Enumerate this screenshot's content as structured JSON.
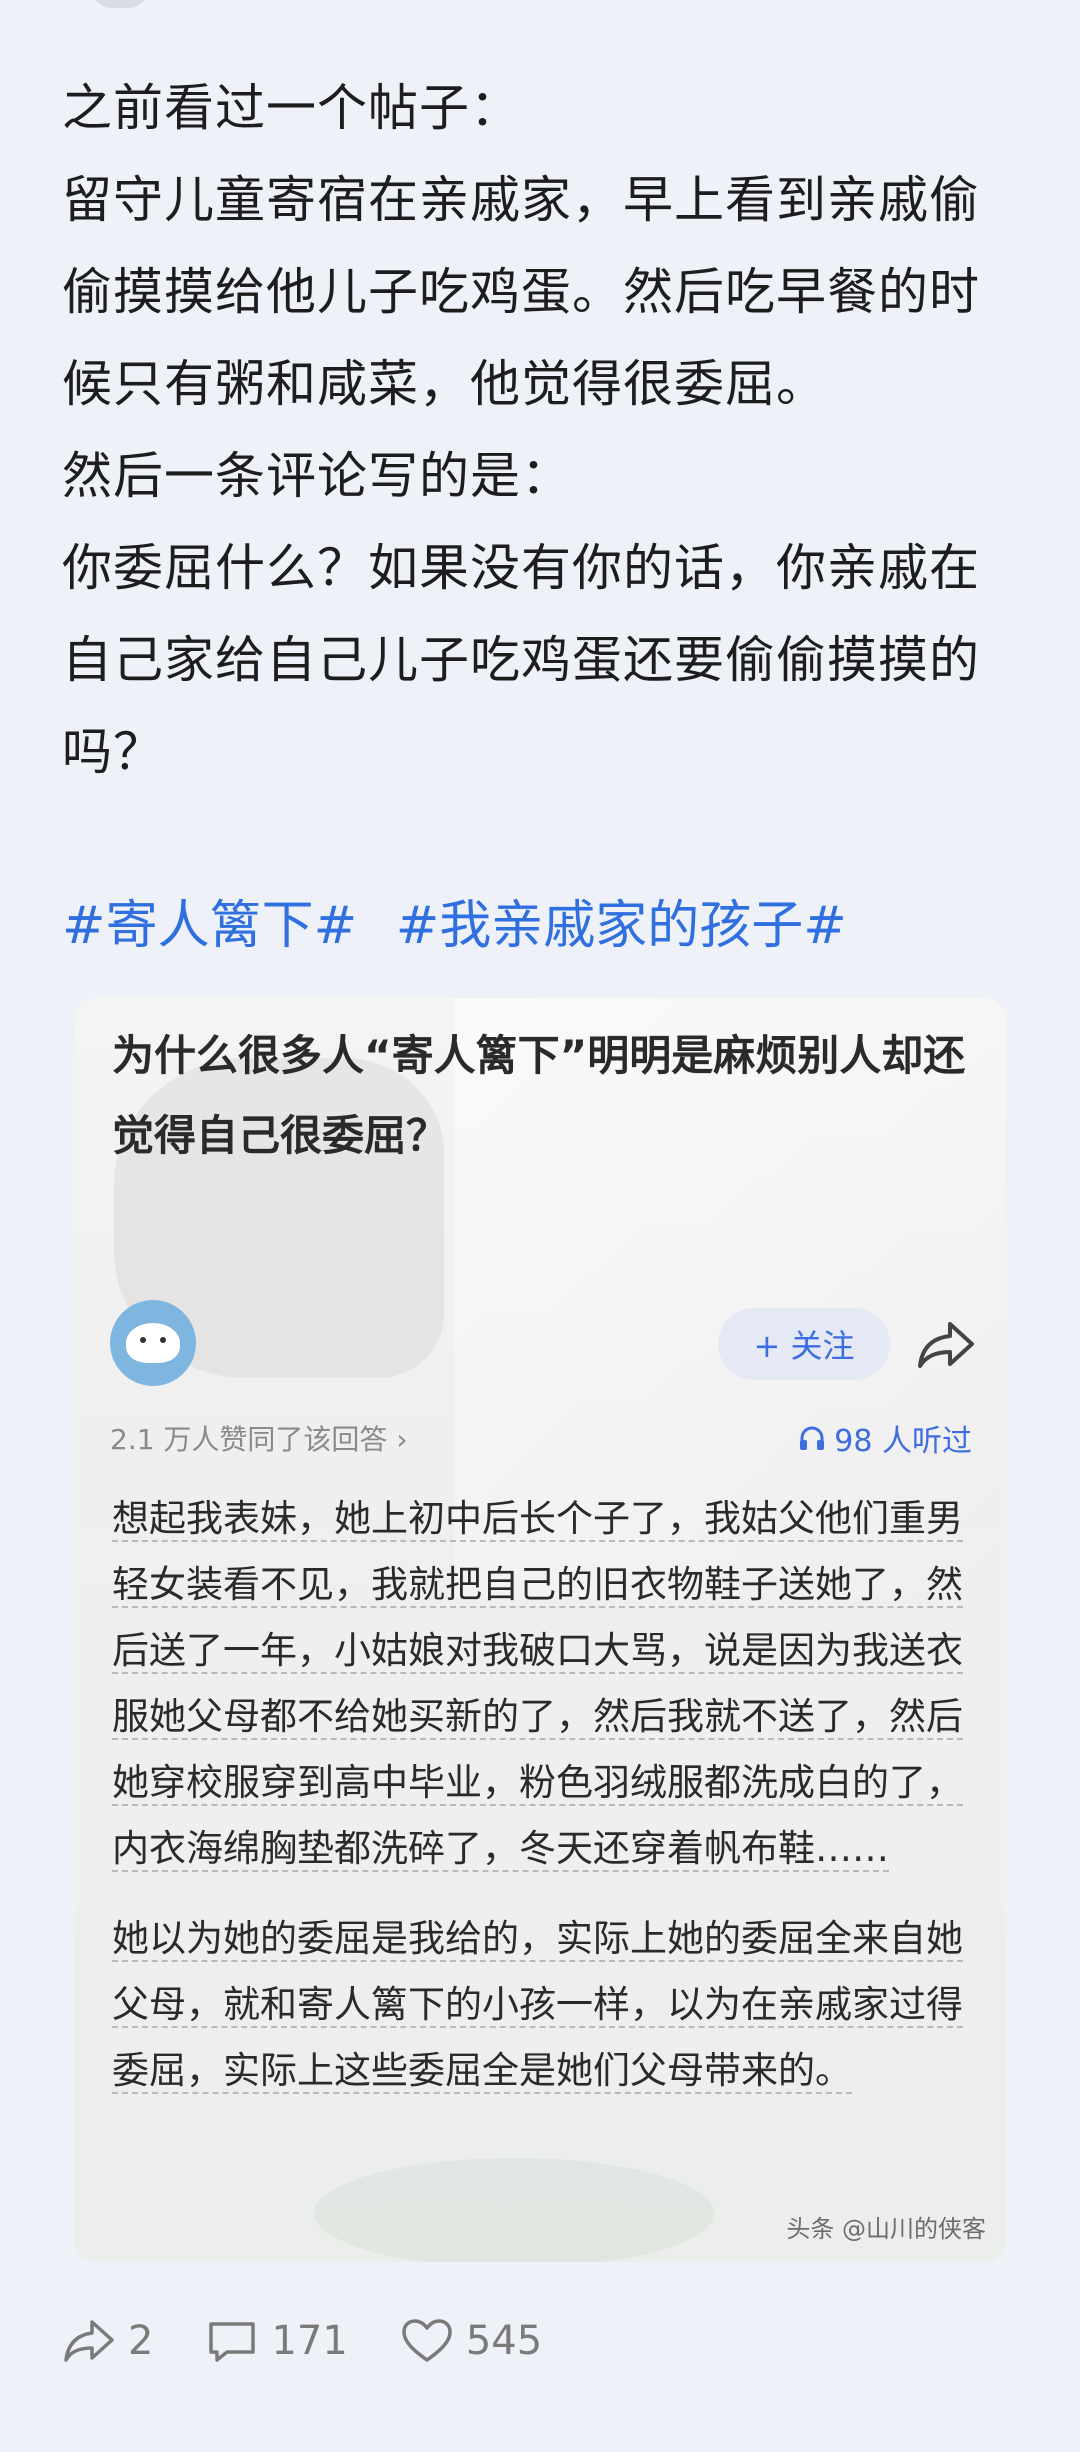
{
  "post": {
    "lines": [
      "之前看过一个帖子：",
      "留守儿童寄宿在亲戚家，早上看到亲戚偷偷摸摸给他儿子吃鸡蛋。然后吃早餐的时候只有粥和咸菜，他觉得很委屈。",
      "然后一条评论写的是：",
      "你委屈什么？如果没有你的话，你亲戚在自己家给自己儿子吃鸡蛋还要偷偷摸摸的吗？"
    ],
    "hashtags": [
      "#寄人篱下#",
      "#我亲戚家的孩子#"
    ]
  },
  "card": {
    "title": "为什么很多人“寄人篱下”明明是麻烦别人却还觉得自己很委屈？",
    "follow_label": "+ 关注",
    "likes_agreed": "2.1 万人赞同了该回答 ›",
    "listened": "98 人听过",
    "answer_paragraphs": [
      "想起我表妹，她上初中后长个子了，我姑父他们重男轻女装看不见，我就把自己的旧衣物鞋子送她了，然后送了一年，小姑娘对我破口大骂，说是因为我送衣服她父母都不给她买新的了，然后我就不送了，然后她穿校服穿到高中毕业，粉色羽绒服都洗成白的了，内衣海绵胸垫都洗碎了，冬天还穿着帆布鞋……",
      "她以为她的委屈是我给的，实际上她的委屈全来自她父母，就和寄人篱下的小孩一样，以为在亲戚家过得委屈，实际上这些委屈全是她们父母带来的。"
    ],
    "watermark": "头条 @山川的侠客"
  },
  "actions": {
    "share_count": "2",
    "comment_count": "171",
    "like_count": "545"
  },
  "icons": {
    "share": "share-icon",
    "comment": "comment-icon",
    "like": "heart-icon",
    "headphones": "headphones-icon",
    "forward": "forward-arrow-icon"
  },
  "colors": {
    "hashtag": "#2f6fe0",
    "accent": "#3d6de0",
    "background": "#eef1f7"
  }
}
